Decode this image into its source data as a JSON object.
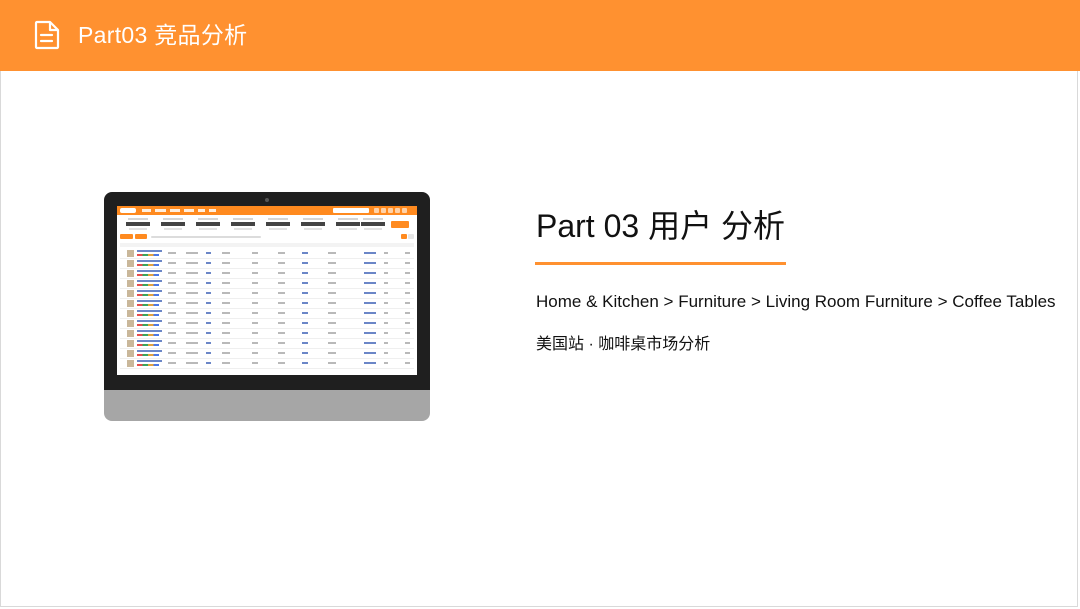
{
  "header": {
    "title": "Part03 竞品分析",
    "icon": "document-icon",
    "background_color": "#ff9130"
  },
  "main": {
    "title": "Part 03  用户 分析",
    "breadcrumb": "Home & Kitchen > Furniture > Living Room Furniture > Coffee Tables",
    "subtitle": "美国站 · 咖啡桌市场分析",
    "accent_color": "#ff9130"
  },
  "illustration": {
    "type": "monitor-screenshot",
    "screen_accent_color": "#ff8a1f"
  }
}
